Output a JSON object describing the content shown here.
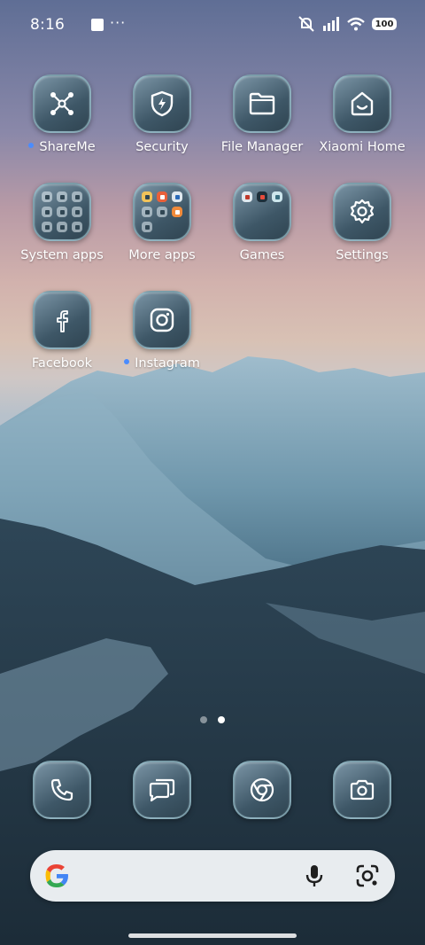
{
  "status_bar": {
    "time": "8:16",
    "overflow": "···",
    "battery": "100",
    "icons": [
      "notification-box-icon",
      "mute-icon",
      "signal-icon",
      "wifi-icon",
      "battery-icon"
    ]
  },
  "apps": [
    {
      "name": "ShareMe",
      "icon": "share-network-icon",
      "new_dot": true
    },
    {
      "name": "Security",
      "icon": "shield-bolt-icon",
      "new_dot": false
    },
    {
      "name": "File Manager",
      "icon": "folder-icon",
      "new_dot": false
    },
    {
      "name": "Xiaomi Home",
      "icon": "home-smile-icon",
      "new_dot": false
    },
    {
      "name": "System apps",
      "icon": "folder-grid-icon",
      "new_dot": false
    },
    {
      "name": "More apps",
      "icon": "folder-grid-icon",
      "new_dot": false
    },
    {
      "name": "Games",
      "icon": "folder-grid-icon",
      "new_dot": false
    },
    {
      "name": "Settings",
      "icon": "gear-icon",
      "new_dot": false
    },
    {
      "name": "Facebook",
      "icon": "facebook-icon",
      "new_dot": false
    },
    {
      "name": "Instagram",
      "icon": "instagram-icon",
      "new_dot": true
    }
  ],
  "pager": {
    "pages": 2,
    "active": 2
  },
  "dock": [
    {
      "icon": "phone-icon"
    },
    {
      "icon": "messages-icon"
    },
    {
      "icon": "chrome-icon"
    },
    {
      "icon": "camera-icon"
    }
  ],
  "search_bar": {
    "logo": "google-g-icon",
    "actions": [
      "mic-icon",
      "google-lens-icon"
    ]
  },
  "colors": {
    "accent_dot": "#4a8cff",
    "tile_dark": "#3e5767",
    "tile_border": "#a0c8d2"
  }
}
